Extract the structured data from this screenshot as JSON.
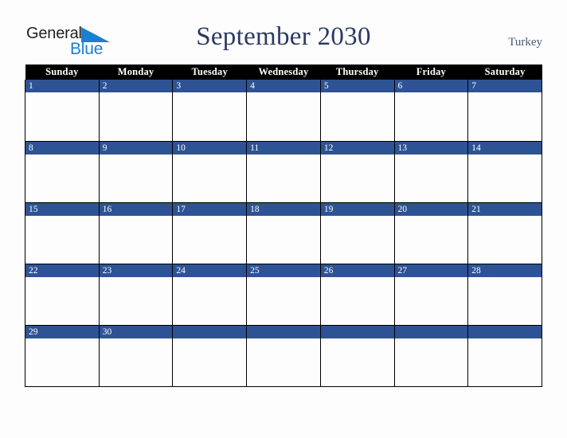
{
  "logo": {
    "word_one": "General",
    "word_two": "Blue",
    "triangle_icon": "blue-triangle-icon",
    "brand_blue": "#1b7fd4",
    "brand_black": "#231f20"
  },
  "header": {
    "title": "September 2030",
    "region": "Turkey",
    "title_color": "#2b3a62",
    "region_color": "#4a5878"
  },
  "calendar": {
    "month": "September",
    "year": "2030",
    "weekday_headers": [
      "Sunday",
      "Monday",
      "Tuesday",
      "Wednesday",
      "Thursday",
      "Friday",
      "Saturday"
    ],
    "header_bg": "#000000",
    "header_text_color": "#ffffff",
    "date_band_bg": "#2e5395",
    "date_band_text_color": "#ffffff",
    "cell_bg": "#fdfdfd",
    "grid_line_color": "#000000",
    "weeks": [
      {
        "days": [
          {
            "date": "1",
            "events": []
          },
          {
            "date": "2",
            "events": []
          },
          {
            "date": "3",
            "events": []
          },
          {
            "date": "4",
            "events": []
          },
          {
            "date": "5",
            "events": []
          },
          {
            "date": "6",
            "events": []
          },
          {
            "date": "7",
            "events": []
          }
        ]
      },
      {
        "days": [
          {
            "date": "8",
            "events": []
          },
          {
            "date": "9",
            "events": []
          },
          {
            "date": "10",
            "events": []
          },
          {
            "date": "11",
            "events": []
          },
          {
            "date": "12",
            "events": []
          },
          {
            "date": "13",
            "events": []
          },
          {
            "date": "14",
            "events": []
          }
        ]
      },
      {
        "days": [
          {
            "date": "15",
            "events": []
          },
          {
            "date": "16",
            "events": []
          },
          {
            "date": "17",
            "events": []
          },
          {
            "date": "18",
            "events": []
          },
          {
            "date": "19",
            "events": []
          },
          {
            "date": "20",
            "events": []
          },
          {
            "date": "21",
            "events": []
          }
        ]
      },
      {
        "days": [
          {
            "date": "22",
            "events": []
          },
          {
            "date": "23",
            "events": []
          },
          {
            "date": "24",
            "events": []
          },
          {
            "date": "25",
            "events": []
          },
          {
            "date": "26",
            "events": []
          },
          {
            "date": "27",
            "events": []
          },
          {
            "date": "28",
            "events": []
          }
        ]
      },
      {
        "days": [
          {
            "date": "29",
            "events": []
          },
          {
            "date": "30",
            "events": []
          },
          {
            "date": "",
            "events": []
          },
          {
            "date": "",
            "events": []
          },
          {
            "date": "",
            "events": []
          },
          {
            "date": "",
            "events": []
          },
          {
            "date": "",
            "events": []
          }
        ]
      }
    ]
  }
}
